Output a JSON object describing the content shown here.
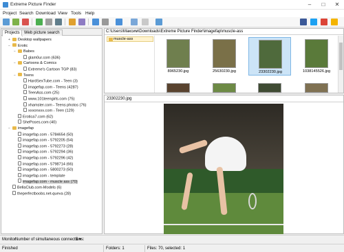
{
  "window": {
    "title": "Extreme Picture Finder"
  },
  "menu": [
    "Project",
    "Search",
    "Download",
    "View",
    "Tools",
    "Help"
  ],
  "tabs": [
    "Projects",
    "Web picture search"
  ],
  "tree": [
    {
      "label": "Desktop wallpapers",
      "icon": "folder-icon"
    },
    {
      "label": "Erotic",
      "icon": "folder-icon"
    },
    {
      "label": "Babes",
      "icon": "folder-icon"
    },
    {
      "label": "glam0ur.com (636)",
      "icon": "page-icon"
    },
    {
      "label": "Cartoons & Comics",
      "icon": "folder-icon"
    },
    {
      "label": "Extreme's Cartoon TGP (83)",
      "icon": "page-icon"
    },
    {
      "label": "Teens",
      "icon": "folder-icon"
    },
    {
      "label": "HardSexTube.com - Teen (3)",
      "icon": "page-icon"
    },
    {
      "label": "imagefap.com - Teens (4287)",
      "icon": "page-icon"
    },
    {
      "label": "TeenAss.com (25)",
      "icon": "page-icon"
    },
    {
      "label": "www.101teengirls.com (75)",
      "icon": "page-icon"
    },
    {
      "label": "xhamster.com - Teens photos (76)",
      "icon": "page-icon"
    },
    {
      "label": "xxxonxxx.com - Teen (129)",
      "icon": "page-icon"
    },
    {
      "label": "Erotica7.com (62)",
      "icon": "page-icon"
    },
    {
      "label": "ShePoses.com (40)",
      "icon": "page-icon"
    },
    {
      "label": "imagefap",
      "icon": "folder-icon"
    },
    {
      "label": "imagefap.com - 5784654 (50)",
      "icon": "page-icon"
    },
    {
      "label": "imagefap.com - 5792205 (54)",
      "icon": "page-icon"
    },
    {
      "label": "imagefap.com - 5792273 (28)",
      "icon": "page-icon"
    },
    {
      "label": "imagefap.com - 5792294 (36)",
      "icon": "page-icon"
    },
    {
      "label": "imagefap.com - 5792296 (42)",
      "icon": "page-icon"
    },
    {
      "label": "imagefap.com - 5798714 (66)",
      "icon": "page-icon"
    },
    {
      "label": "imagefap.com - 5800273 (50)",
      "icon": "page-icon"
    },
    {
      "label": "imagefap.com - template",
      "icon": "page-icon"
    },
    {
      "label": "imagefap.com - muscle ass (70)",
      "icon": "page-icon"
    },
    {
      "label": "BellaClub.com-Models (6)",
      "icon": "page-icon"
    },
    {
      "label": "theperfectboobs.net-queva (28)",
      "icon": "page-icon"
    }
  ],
  "path": "C:\\Users\\Максим\\Downloads\\Extreme Picture Finder\\imagefap\\muscle-ass",
  "folders": [
    "muscle-ass"
  ],
  "thumbnails": [
    {
      "caption": "8965230.jpg"
    },
    {
      "caption": "25630230.jpg"
    },
    {
      "caption": "23302230.jpg"
    },
    {
      "caption": "1038145526.jpg"
    }
  ],
  "preview": {
    "filename": "23302230.jpg"
  },
  "status": {
    "monitor_label": "Monitor:",
    "connections_label": "Number of simultaneous connections:",
    "connections_value": "5",
    "state": "Finished",
    "folders": "Folders: 1",
    "files": "Files: 70, selected: 1"
  },
  "colors": {
    "accent": "#3d8bd4",
    "selection": "#cce4f7",
    "folder": "#e8b94a"
  }
}
